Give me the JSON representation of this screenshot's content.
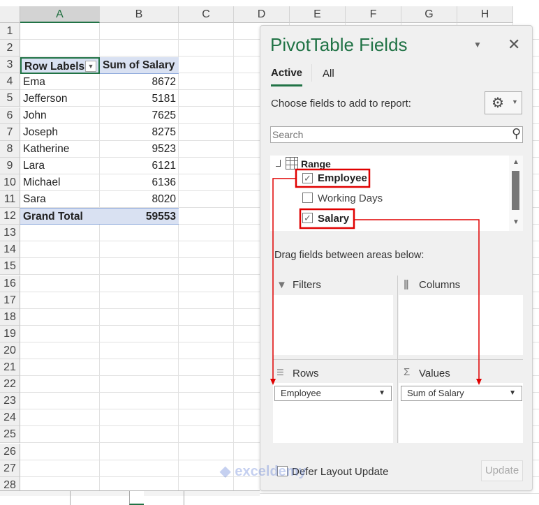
{
  "columns": [
    "A",
    "B",
    "C",
    "D",
    "E",
    "F",
    "G",
    "H"
  ],
  "rows": [
    "1",
    "2",
    "3",
    "4",
    "5",
    "6",
    "7",
    "8",
    "9",
    "10",
    "11",
    "12",
    "13",
    "14",
    "15",
    "16",
    "17",
    "18",
    "19",
    "20",
    "21",
    "22",
    "23",
    "24",
    "25",
    "26",
    "27",
    "28"
  ],
  "pivot": {
    "header": [
      "Row Labels",
      "Sum of Salary"
    ],
    "data": [
      [
        "Ema",
        "8672"
      ],
      [
        "Jefferson",
        "5181"
      ],
      [
        "John",
        "7625"
      ],
      [
        "Joseph",
        "8275"
      ],
      [
        "Katherine",
        "9523"
      ],
      [
        "Lara",
        "6121"
      ],
      [
        "Michael",
        "6136"
      ],
      [
        "Sara",
        "8020"
      ]
    ],
    "total": [
      "Grand Total",
      "59553"
    ]
  },
  "panel": {
    "title": "PivotTable Fields",
    "tabs": [
      "Active",
      "All"
    ],
    "choose_label": "Choose fields to add to report:",
    "search_placeholder": "Search",
    "range_label": "Range",
    "fields": [
      {
        "name": "Employee",
        "checked": true
      },
      {
        "name": "Working Days",
        "checked": false
      },
      {
        "name": "Salary",
        "checked": true
      }
    ],
    "drag_label": "Drag fields between areas below:",
    "areas": {
      "filters": "Filters",
      "columns": "Columns",
      "rows": "Rows",
      "values": "Values"
    },
    "rows_item": "Employee",
    "values_item": "Sum of Salary",
    "defer_label": "Defer Layout Update",
    "update_label": "Update"
  },
  "watermark": "exceldemy",
  "colors": {
    "accent": "#217346",
    "title": "#217346",
    "highlight": "#e00000"
  }
}
